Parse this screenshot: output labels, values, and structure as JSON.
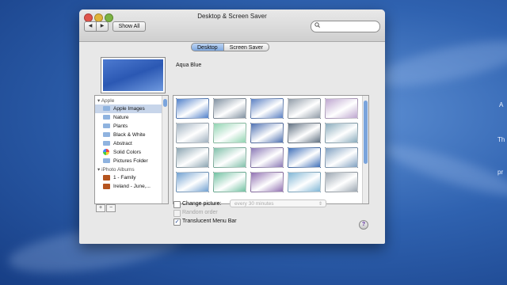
{
  "window": {
    "title": "Desktop & Screen Saver",
    "back_icon": "◀",
    "forward_icon": "▶",
    "show_all_label": "Show All",
    "search_icon": "🔍",
    "search_value": "",
    "search_placeholder": ""
  },
  "tabs": [
    {
      "label": "Desktop",
      "selected": true
    },
    {
      "label": "Screen Saver",
      "selected": false
    }
  ],
  "current_picture": {
    "name": "Aqua Blue"
  },
  "sidebar": {
    "apple_header": "Apple",
    "apple_items": [
      {
        "label": "Apple Images",
        "icon": "folder-icon",
        "selected": true
      },
      {
        "label": "Nature",
        "icon": "folder-icon",
        "selected": false
      },
      {
        "label": "Plants",
        "icon": "folder-icon",
        "selected": false
      },
      {
        "label": "Black & White",
        "icon": "folder-icon",
        "selected": false
      },
      {
        "label": "Abstract",
        "icon": "folder-icon",
        "selected": false
      },
      {
        "label": "Solid Colors",
        "icon": "color-wheel-icon",
        "selected": false
      },
      {
        "label": "Pictures Folder",
        "icon": "folder-icon",
        "selected": false
      }
    ],
    "iphoto_header": "iPhoto Albums",
    "iphoto_items": [
      {
        "label": "1 - Family",
        "icon": "album-icon"
      },
      {
        "label": "Ireland - June,...",
        "icon": "album-icon"
      }
    ],
    "add_label": "+",
    "remove_label": "−"
  },
  "thumbnail_colors": [
    "#4f7fc9",
    "#7f8f9f",
    "#5a7fc2",
    "#8f9aa6",
    "#bda5cf",
    "#9fb0bf",
    "#8fd3b0",
    "#4d6fb0",
    "#5f6f80",
    "#88aabb",
    "#8aa3b0",
    "#7fbfa8",
    "#8a78b5",
    "#3f6fb8",
    "#7f9fc0",
    "#6f9fd0",
    "#6fc0a0",
    "#8f6fb0",
    "#7fb5d5",
    "#9aa5b0"
  ],
  "options": {
    "change_picture_label": "Change picture:",
    "change_picture_checked": false,
    "interval_value": "every 30 minutes",
    "interval_arrow": "⇕",
    "random_order_label": "Random order",
    "random_order_checked": false,
    "translucent_label": "Translucent Menu Bar",
    "translucent_checked": true,
    "check_mark": "✓",
    "help_label": "?"
  },
  "desktop_edge_text": [
    "A",
    "Th",
    "pr"
  ],
  "colors": {
    "accent_blue": "#7aa4dc",
    "selection": "#c7d5ea"
  }
}
